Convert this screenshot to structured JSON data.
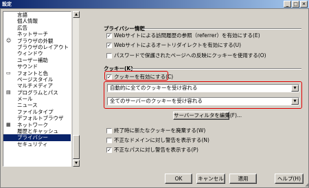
{
  "window": {
    "title": "設定"
  },
  "titlebar_buttons": [
    "_",
    "□",
    "✕"
  ],
  "sidebar": {
    "items": [
      {
        "label": "言語",
        "icon": ""
      },
      {
        "label": "個人情報",
        "icon": ""
      },
      {
        "label": "広告",
        "icon": ""
      },
      {
        "label": "ネットサーチ",
        "icon": ""
      },
      {
        "label": "ブラウザの外観",
        "icon": "☺"
      },
      {
        "label": "ブラウザのレイアウト",
        "icon": ""
      },
      {
        "label": "ウィンドウ",
        "icon": ""
      },
      {
        "label": "ユーザー補助",
        "icon": ""
      },
      {
        "label": "サウンド",
        "icon": ""
      },
      {
        "label": "フォントと色",
        "icon": "▭"
      },
      {
        "label": "ページスタイル",
        "icon": ""
      },
      {
        "label": "マルチメディア",
        "icon": ""
      },
      {
        "label": "プログラムとパス",
        "icon": "▤"
      },
      {
        "label": "メール",
        "icon": ""
      },
      {
        "label": "ニュース",
        "icon": ""
      },
      {
        "label": "ファイルタイプ",
        "icon": ""
      },
      {
        "label": "デフォルトブラウザ",
        "icon": ""
      },
      {
        "label": "ネットワーク",
        "icon": "▦"
      },
      {
        "label": "履歴とキャッシュ",
        "icon": ""
      },
      {
        "label": "プライバシー",
        "icon": ""
      },
      {
        "label": "セキュリティ",
        "icon": ""
      }
    ],
    "selected": "プライバシー"
  },
  "privacy": {
    "title": "プライバシー情報",
    "checks": [
      {
        "label": "Webサイトによる訪問履歴の参照（referrer）を有効にする(E)",
        "checked": true
      },
      {
        "label": "Webサイトによるオートリダイレクトを有効にする(U)",
        "checked": true
      },
      {
        "label": "パスワードで保護されたページへの反映にクッキーを使用する(O)",
        "checked": false
      }
    ]
  },
  "cookies": {
    "title": "クッキー(K)",
    "enable": {
      "label": "クッキーを有効にする(C)",
      "checked": true
    },
    "select1": "自動的に全てのクッキーを受け容れる",
    "select2": "全てのサーバーのクッキーを受け容れる",
    "filter_button": "サーバーフィルタを編集(F)...",
    "checks": [
      {
        "label": "終了時に新たなクッキーを廃棄する(W)",
        "checked": false
      },
      {
        "label": "不正なドメインに対し警告を表示する(N)",
        "checked": false
      },
      {
        "label": "不正なパスに対し警告を表示する(P)",
        "checked": true
      }
    ]
  },
  "footer": {
    "ok": "OK",
    "cancel": "キャンセル",
    "apply": "適用",
    "help": "ヘルプ(H)"
  },
  "highlight_color": "#e00000"
}
